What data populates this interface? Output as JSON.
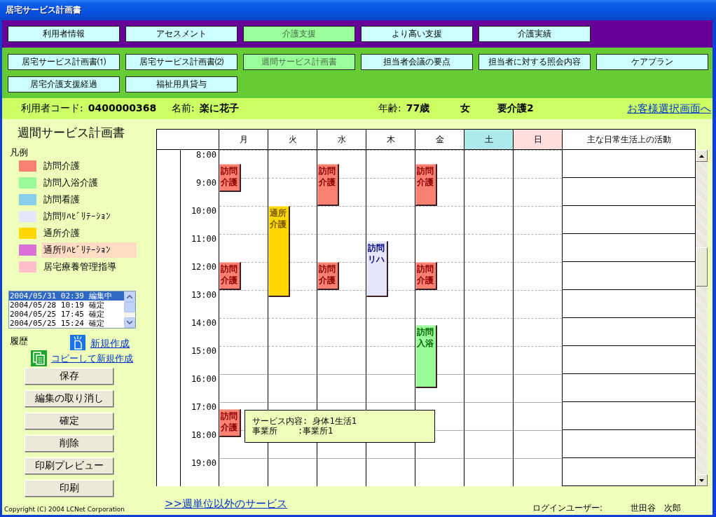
{
  "window": {
    "title": "居宅サービス計画書"
  },
  "main_nav": [
    {
      "label": "利用者情報",
      "selected": false
    },
    {
      "label": "アセスメント",
      "selected": false
    },
    {
      "label": "介護支援",
      "selected": true
    },
    {
      "label": "より高い支援",
      "selected": false
    },
    {
      "label": "介護実績",
      "selected": false
    }
  ],
  "sub_nav": [
    {
      "label": "居宅サービス計画書⑴",
      "selected": false
    },
    {
      "label": "居宅サービス計画書⑵",
      "selected": false
    },
    {
      "label": "週間サービス計画書",
      "selected": true
    },
    {
      "label": "担当者会議の要点",
      "selected": false
    },
    {
      "label": "担当者に対する照会内容",
      "selected": false
    },
    {
      "label": "ケアプラン",
      "selected": false
    },
    {
      "label": "居宅介護支援経過",
      "selected": false
    },
    {
      "label": "福祉用具貸与",
      "selected": false
    }
  ],
  "client_info": {
    "code_label": "利用者コード:",
    "code": "0400000368",
    "name_label": "名前:",
    "name": "楽に花子",
    "age_label": "年齢:",
    "age": "77歳",
    "sex": "女",
    "care_level": "要介護2",
    "select_link": "お客様選択画面へ"
  },
  "sidebar": {
    "title": "週間サービス計画書",
    "legend_title": "凡例",
    "legend": [
      {
        "label": "訪問介護",
        "color": "#fa8072",
        "selected": false
      },
      {
        "label": "訪問入浴介護",
        "color": "#98fb98",
        "selected": false
      },
      {
        "label": "訪問看護",
        "color": "#87ceeb",
        "selected": false
      },
      {
        "label": "訪問ﾘﾊﾋﾞﾘﾃｰｼｮﾝ",
        "color": "#e6e6fa",
        "selected": false
      },
      {
        "label": "通所介護",
        "color": "#ffd700",
        "selected": false
      },
      {
        "label": "通所ﾘﾊﾋﾞﾘﾃｰｼｮﾝ",
        "color": "#da70d6",
        "selected": true
      },
      {
        "label": "居宅療養管理指導",
        "color": "#ffc0cb",
        "selected": false
      }
    ],
    "history": [
      {
        "label": "2004/05/31 02:39 編集中",
        "selected": true
      },
      {
        "label": "2004/05/28 10:19 確定",
        "selected": false
      },
      {
        "label": "2004/05/25 17:45 確定",
        "selected": false
      },
      {
        "label": "2004/05/25 15:24 確定",
        "selected": false
      }
    ],
    "history_label": "履歴",
    "new_link": "新規作成",
    "copy_link": "コピーして新規作成",
    "buttons": [
      "保存",
      "編集の取り消し",
      "確定",
      "削除",
      "印刷プレビュー",
      "印刷"
    ],
    "copyright": "Copyright (C) 2004 LCNet Corporation"
  },
  "schedule": {
    "days": [
      {
        "label": "月",
        "kind": "weekday",
        "events": [
          {
            "label": "訪問介護",
            "kind": "homecare",
            "color": "#fa8072"
          },
          {
            "label": "訪問介護",
            "kind": "homecare",
            "color": "#fa8072"
          },
          {
            "label": "訪問介護",
            "kind": "homecare",
            "color": "#fa8072",
            "tooltip": [
              "サービス内容: 身体1生活1",
              "事業所    :事業所1"
            ]
          }
        ]
      },
      {
        "label": "火",
        "kind": "weekday",
        "events": [
          {
            "label": "通所介護",
            "kind": "daycare",
            "color": "#ffd700"
          }
        ]
      },
      {
        "label": "水",
        "kind": "weekday",
        "events": [
          {
            "label": "訪問介護",
            "kind": "homecare",
            "color": "#fa8072"
          },
          {
            "label": "訪問介護",
            "kind": "homecare",
            "color": "#fa8072"
          }
        ]
      },
      {
        "label": "木",
        "kind": "weekday",
        "events": [
          {
            "label": "訪問リハ",
            "kind": "rehab",
            "color": "#e6e6fa"
          }
        ]
      },
      {
        "label": "金",
        "kind": "weekday",
        "events": [
          {
            "label": "訪問介護",
            "kind": "homecare",
            "color": "#fa8072"
          },
          {
            "label": "訪問介護",
            "kind": "homecare",
            "color": "#fa8072"
          },
          {
            "label": "訪問入浴",
            "kind": "bathing",
            "color": "#98fb98"
          }
        ]
      },
      {
        "label": "土",
        "kind": "saturday"
      },
      {
        "label": "日",
        "kind": "sunday"
      }
    ],
    "activity_header": "主な日常生活上の活動",
    "times": [
      "8:00",
      "9:00",
      "10:00",
      "11:00",
      "12:00",
      "13:00",
      "14:00",
      "15:00",
      "16:00",
      "17:00",
      "18:00",
      "19:00"
    ]
  },
  "footer": {
    "link": ">>週単位以外のサービス",
    "login_label": "ログインユーザー:",
    "login_user": "世田谷　次郎"
  }
}
